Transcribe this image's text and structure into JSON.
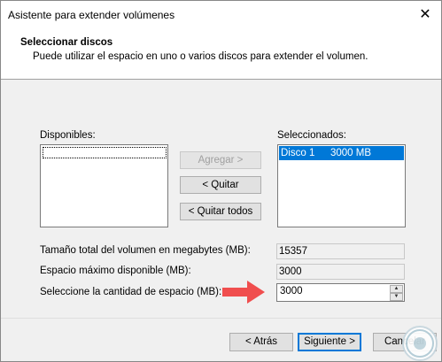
{
  "window": {
    "title": "Asistente para extender volúmenes",
    "close_glyph": "✕"
  },
  "header": {
    "title": "Seleccionar discos",
    "subtitle": "Puede utilizar el espacio en uno o varios discos para extender el volumen."
  },
  "available": {
    "label": "Disponibles:",
    "items": []
  },
  "selected": {
    "label": "Seleccionados:",
    "items": [
      {
        "name": "Disco 1",
        "size": "3000 MB"
      }
    ]
  },
  "buttons": {
    "add": "Agregar >",
    "remove": "< Quitar",
    "remove_all": "< Quitar todos",
    "back": "< Atrás",
    "next": "Siguiente >",
    "cancel": "Cancelar"
  },
  "fields": {
    "total_label": "Tamaño total del volumen en megabytes (MB):",
    "total_value": "15357",
    "max_label": "Espacio máximo disponible (MB):",
    "max_value": "3000",
    "amount_label": "Seleccione la cantidad de espacio (MB):",
    "amount_value": "3000"
  },
  "colors": {
    "accent": "#0078d7",
    "arrow": "#f04e4e"
  },
  "icons": {
    "arrow": "right-arrow-icon",
    "spin_up": "spin-up-icon",
    "spin_down": "spin-down-icon",
    "logo": "watermark-logo"
  }
}
